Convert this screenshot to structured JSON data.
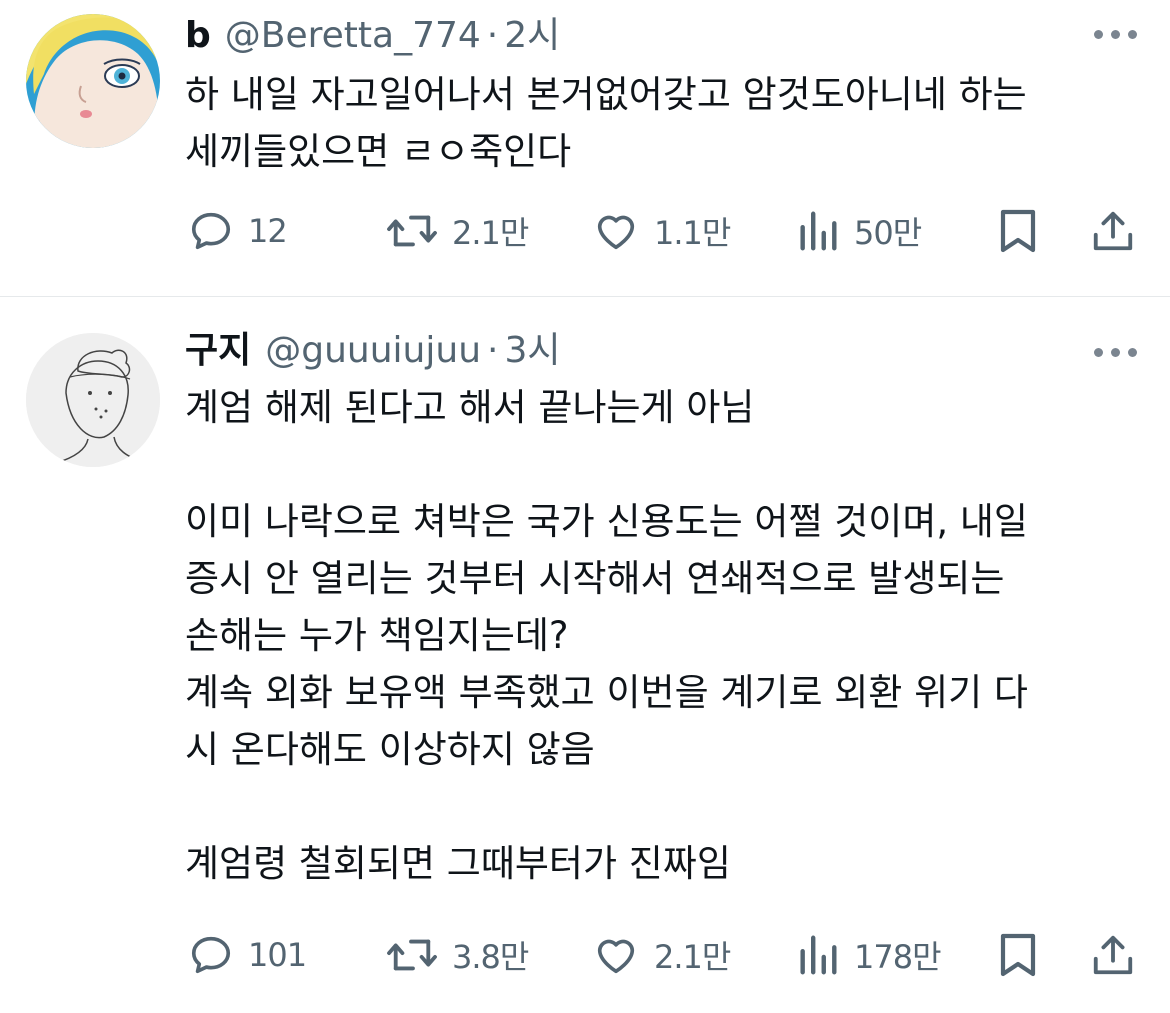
{
  "tweets": [
    {
      "name": "b",
      "handle": "@Beretta_774",
      "separator": "·",
      "time": "2시",
      "lines": [
        "하 내일 자고일어나서 본거없어갖고 암것도아니네 하는",
        "세끼들있으면 ㄹㅇ죽인다"
      ],
      "stats": {
        "replies": "12",
        "retweets": "2.1만",
        "likes": "1.1만",
        "views": "50만"
      }
    },
    {
      "name": "구지",
      "handle": "@guuuiujuu",
      "separator": "·",
      "time": "3시",
      "lines": [
        "계엄 해제 된다고 해서 끝나는게 아님",
        "",
        "이미 나락으로 쳐박은 국가 신용도는 어쩔 것이며, 내일",
        "증시 안 열리는 것부터 시작해서 연쇄적으로 발생되는",
        "손해는 누가 책임지는데?",
        "계속 외화 보유액 부족했고 이번을 계기로 외환 위기 다",
        "시 온다해도 이상하지 않음",
        "",
        "계엄령 철회되면 그때부터가 진짜임"
      ],
      "stats": {
        "replies": "101",
        "retweets": "3.8만",
        "likes": "2.1만",
        "views": "178만"
      }
    }
  ],
  "icons": {
    "reply": "speech-bubble-icon",
    "retweet": "retweet-arrows-icon",
    "like": "heart-icon",
    "views": "bar-chart-icon",
    "bookmark": "bookmark-icon",
    "share": "share-upload-icon",
    "more": "ellipsis-icon"
  },
  "colors": {
    "text": "#0f1419",
    "secondary": "#536471",
    "divider": "#e6e9eb",
    "background": "#ffffff"
  }
}
